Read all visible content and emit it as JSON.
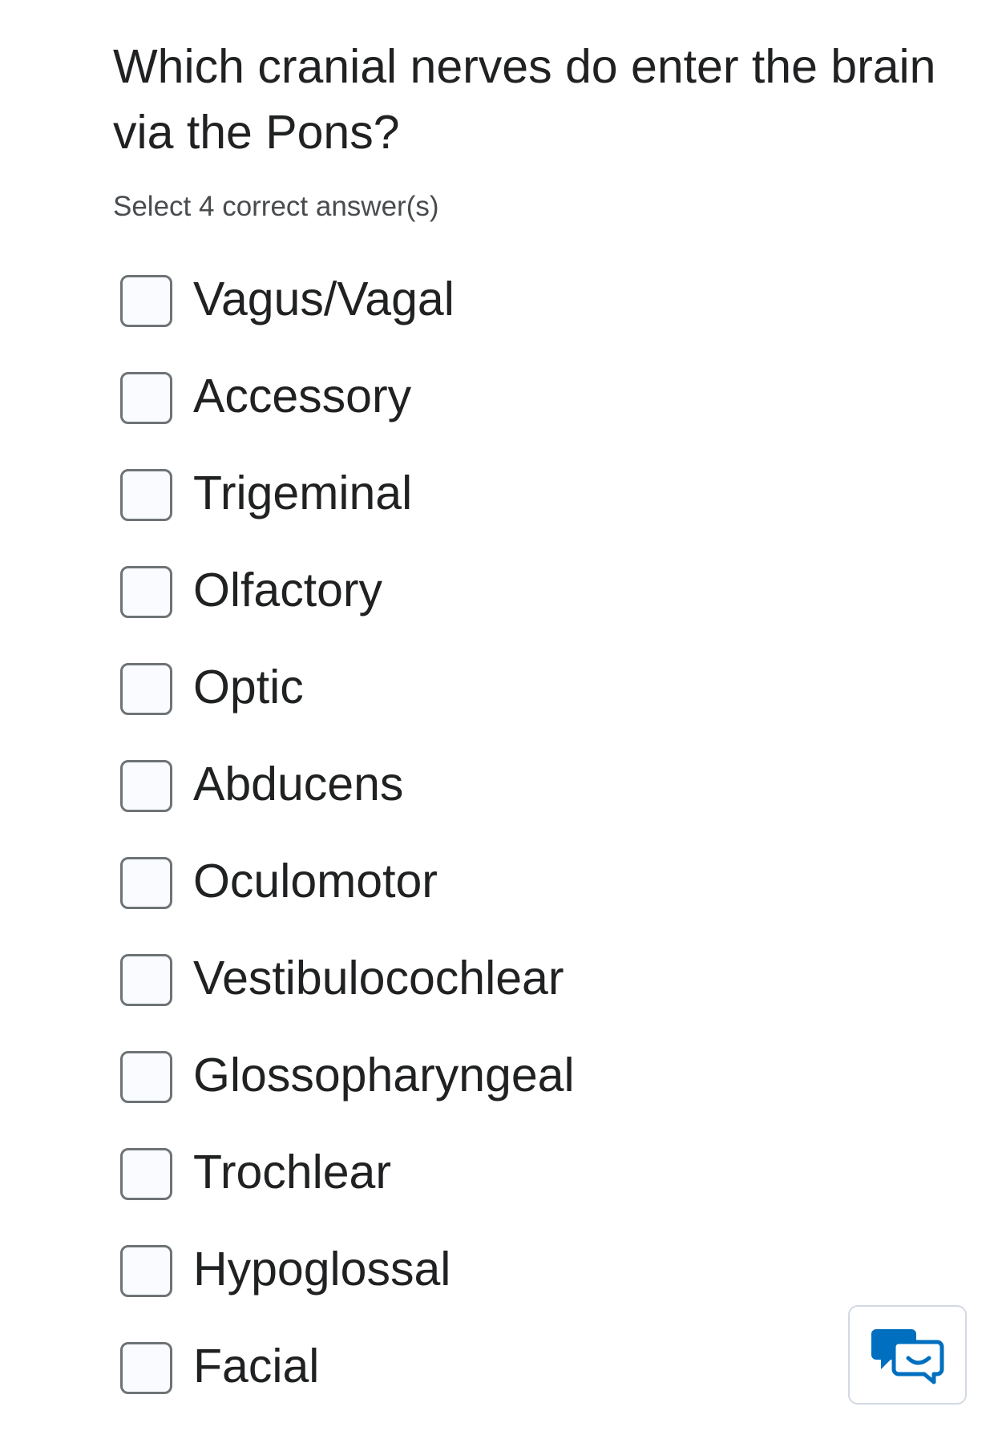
{
  "question": {
    "text": "Which cranial nerves do enter the brain via the Pons?",
    "instruction": "Select 4 correct answer(s)"
  },
  "options": [
    {
      "label": "Vagus/Vagal",
      "checked": false
    },
    {
      "label": "Accessory",
      "checked": false
    },
    {
      "label": "Trigeminal",
      "checked": false
    },
    {
      "label": "Olfactory",
      "checked": false
    },
    {
      "label": "Optic",
      "checked": false
    },
    {
      "label": "Abducens",
      "checked": false
    },
    {
      "label": "Oculomotor",
      "checked": false
    },
    {
      "label": "Vestibulocochlear",
      "checked": false
    },
    {
      "label": "Glossopharyngeal",
      "checked": false
    },
    {
      "label": "Trochlear",
      "checked": false
    },
    {
      "label": "Hypoglossal",
      "checked": false
    },
    {
      "label": "Facial",
      "checked": false
    }
  ],
  "feedback_button": {
    "icon": "chat-feedback-icon",
    "color": "#006fbf"
  },
  "colors": {
    "text": "#202122",
    "instruction": "#494c4e",
    "checkbox_border": "#6e7376",
    "checkbox_fill": "#f9fbff",
    "accent": "#006fbf"
  }
}
